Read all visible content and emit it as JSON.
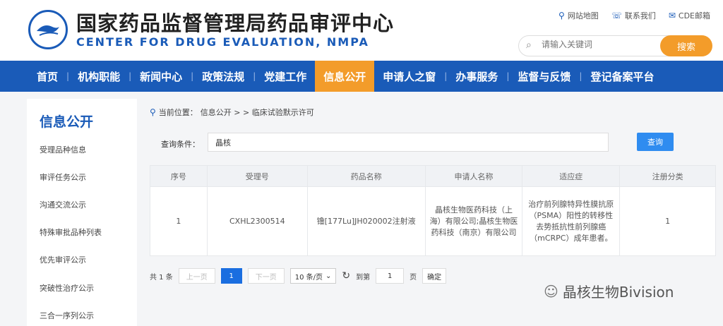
{
  "header": {
    "title_cn": "国家药品监督管理局药品审评中心",
    "title_en": "CENTER FOR DRUG EVALUATION, NMPA",
    "links": [
      {
        "icon": "map-pin-icon",
        "label": "网站地图"
      },
      {
        "icon": "phone-icon",
        "label": "联系我们"
      },
      {
        "icon": "mail-icon",
        "label": "CDE邮箱"
      }
    ],
    "search_placeholder": "请输入关键词",
    "search_button": "搜索"
  },
  "nav": {
    "items": [
      "首页",
      "机构职能",
      "新闻中心",
      "政策法规",
      "党建工作",
      "信息公开",
      "申请人之窗",
      "办事服务",
      "监督与反馈",
      "登记备案平台"
    ],
    "active": "信息公开"
  },
  "sidebar": {
    "title": "信息公开",
    "items": [
      "受理品种信息",
      "审评任务公示",
      "沟通交流公示",
      "特殊审批品种列表",
      "优先审评公示",
      "突破性治疗公示",
      "三合一序列公示"
    ]
  },
  "breadcrumb": {
    "prefix": "当前位置：",
    "path": "信息公开 > > 临床试验默示许可"
  },
  "query": {
    "label": "查询条件：",
    "value": "晶核",
    "button": "查询"
  },
  "table": {
    "headers": [
      "序号",
      "受理号",
      "药品名称",
      "申请人名称",
      "适应症",
      "注册分类"
    ],
    "rows": [
      [
        "1",
        "CXHL2300514",
        "镥[177Lu]JH020002注射液",
        "晶核生物医药科技（上海）有限公司;晶核生物医药科技（南京）有限公司",
        "治疗前列腺特异性膜抗原（PSMA）阳性的转移性去势抵抗性前列腺癌（mCRPC）成年患者。",
        "1"
      ]
    ]
  },
  "pager": {
    "total": "共 1 条",
    "prev": "上一页",
    "current": "1",
    "next": "下一页",
    "page_size": "10 条/页",
    "goto_prefix": "到第",
    "goto_value": "1",
    "goto_suffix": "页",
    "confirm": "确定"
  },
  "watermark": "晶核生物Bivision",
  "colors": {
    "brand_blue": "#1a5bb8",
    "accent_orange": "#f39c2a",
    "button_blue": "#2f8cf0"
  }
}
